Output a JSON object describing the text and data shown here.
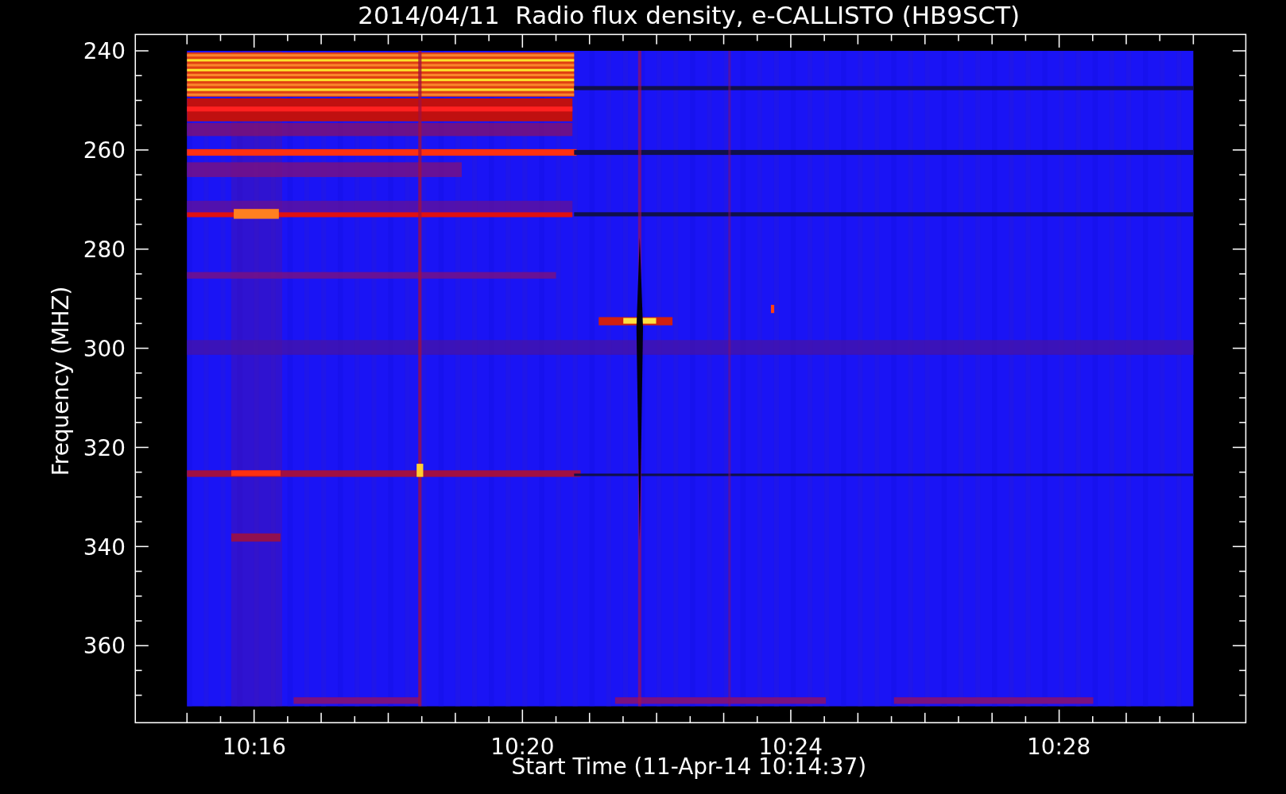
{
  "title": "2014/04/11  Radio flux density, e-CALLISTO (HB9SCT)",
  "y_axis": {
    "label": "Frequency (MHZ)",
    "ticks": [
      "240",
      "260",
      "280",
      "300",
      "320",
      "340",
      "360"
    ]
  },
  "x_axis": {
    "label": "Start Time (11-Apr-14 10:14:37)",
    "ticks": [
      "10:16",
      "10:20",
      "10:24",
      "10:28"
    ]
  }
}
